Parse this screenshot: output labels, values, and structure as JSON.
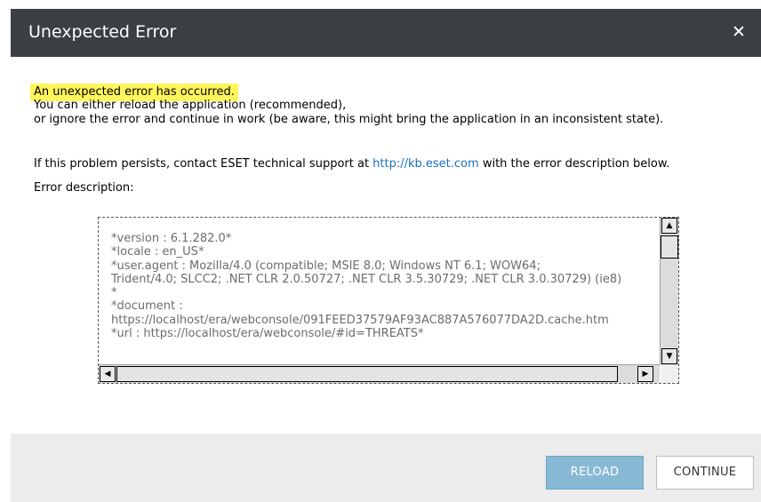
{
  "dialog": {
    "title": "Unexpected Error",
    "close_glyph": "✕"
  },
  "message": {
    "headline": "An unexpected error has occurred.",
    "line2": "You can either reload the application (recommended),",
    "line3": "or ignore the error and continue in work (be aware, this might bring the application in an inconsistent state).",
    "support_prefix": "If this problem persists, contact ESET technical support at ",
    "support_link": "http://kb.eset.com",
    "support_suffix": " with the error description below.",
    "error_label": "Error description:"
  },
  "error_description": "*version : 6.1.282.0*\n*locale : en_US*\n*user.agent : Mozilla/4.0 (compatible; MSIE 8.0; Windows NT 6.1; WOW64;\nTrident/4.0; SLCC2; .NET CLR 2.0.50727; .NET CLR 3.5.30729; .NET CLR 3.0.30729) (ie8)\n*\n*document :\nhttps://localhost/era/webconsole/091FEED37579AF93AC887A576077DA2D.cache.htm\n*url : https://localhost/era/webconsole/#id=THREATS*",
  "buttons": {
    "reload": "RELOAD",
    "continue": "CONTINUE"
  },
  "colors": {
    "titlebar": "#3b3e43",
    "highlight": "#fef65a",
    "link": "#1a6fbf",
    "reload_button": "#87b8d4",
    "footer": "#ececec"
  },
  "icons": {
    "close": "close-icon",
    "scroll_up": "scroll-up-arrow-icon",
    "scroll_down": "scroll-down-arrow-icon",
    "scroll_left": "scroll-left-arrow-icon",
    "scroll_right": "scroll-right-arrow-icon"
  }
}
